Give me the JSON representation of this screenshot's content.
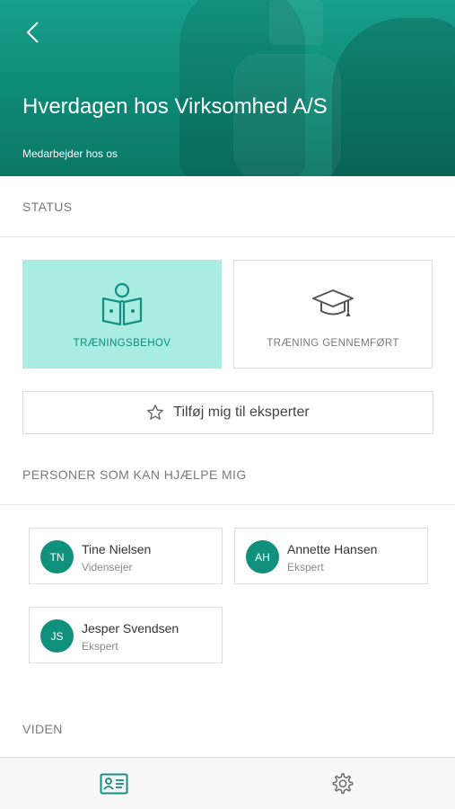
{
  "header": {
    "title": "Hverdagen hos Virksomhed A/S",
    "subtitle": "Medarbejder hos os"
  },
  "status": {
    "section_label": "STATUS",
    "cards": [
      {
        "label": "TRÆNINGSBEHOV",
        "icon": "reading-person-icon",
        "selected": true
      },
      {
        "label": "TRÆNING GENNEMFØRT",
        "icon": "graduation-cap-icon",
        "selected": false
      }
    ],
    "expert_button": {
      "label": "Tilføj mig til eksperter",
      "icon": "star-icon"
    }
  },
  "helpers": {
    "section_label": "PERSONER SOM KAN HJÆLPE MIG",
    "people": [
      {
        "initials": "TN",
        "name": "Tine Nielsen",
        "role": "Vidensejer"
      },
      {
        "initials": "AH",
        "name": "Annette Hansen",
        "role": "Ekspert"
      },
      {
        "initials": "JS",
        "name": "Jesper Svendsen",
        "role": "Ekspert"
      }
    ]
  },
  "knowledge": {
    "section_label": "VIDEN"
  },
  "tabbar": {
    "tabs": [
      {
        "icon": "profile-card-icon",
        "active": true
      },
      {
        "icon": "gear-icon",
        "active": false
      }
    ]
  },
  "colors": {
    "accent": "#12907e",
    "selected_card": "#a8ece2",
    "header": "#0f8d7a"
  }
}
